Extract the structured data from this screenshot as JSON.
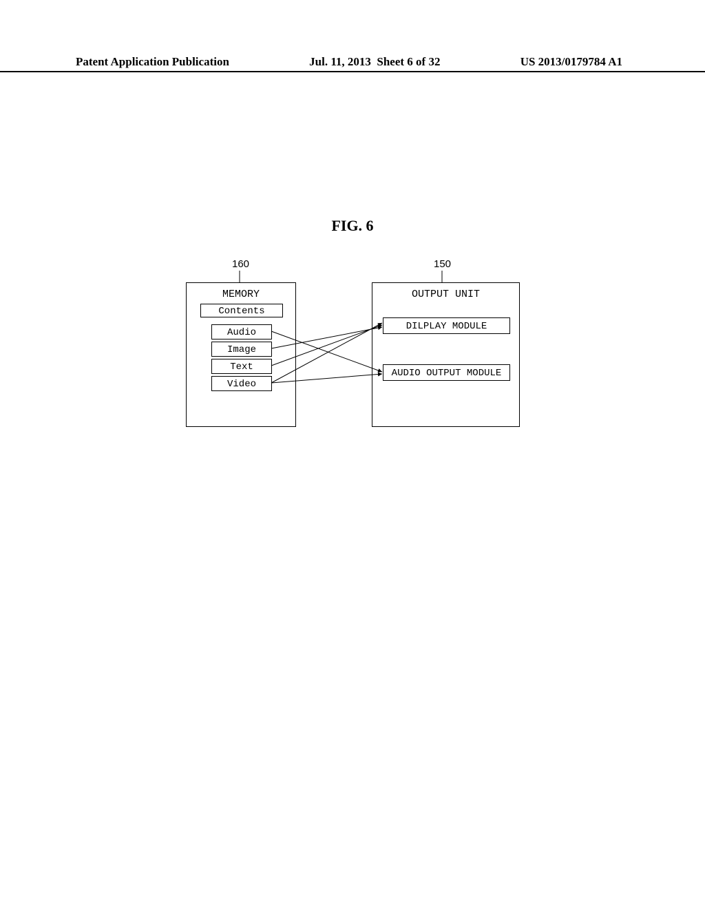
{
  "header": {
    "publication_type": "Patent Application Publication",
    "date": "Jul. 11, 2013",
    "sheet_info": "Sheet 6 of 32",
    "publication_number": "US 2013/0179784 A1"
  },
  "figure": {
    "title": "FIG. 6",
    "ref_left": "160",
    "ref_right": "150",
    "memory": {
      "title": "MEMORY",
      "contents_label": "Contents",
      "items": {
        "audio": "Audio",
        "image": "Image",
        "text": "Text",
        "video": "Video"
      }
    },
    "output": {
      "title": "OUTPUT UNIT",
      "display_module": "DILPLAY MODULE",
      "audio_module": "AUDIO OUTPUT MODULE"
    }
  }
}
